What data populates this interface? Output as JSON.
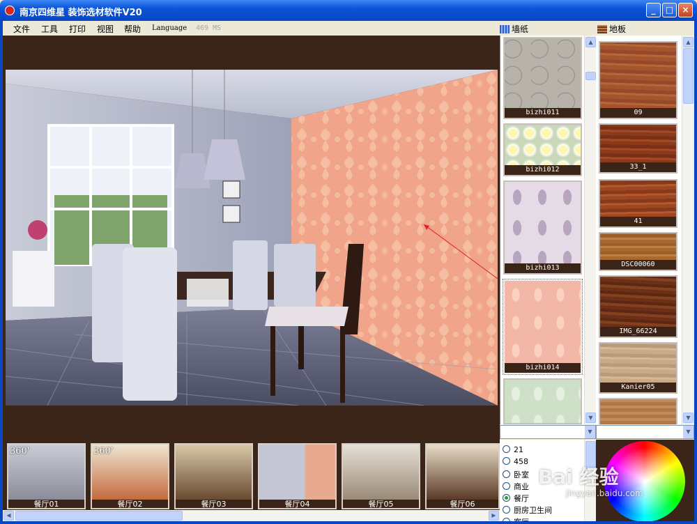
{
  "window": {
    "title": "南京四维星 装饰选材软件V20",
    "minimize": "_",
    "maximize": "□",
    "close": "×"
  },
  "menu": {
    "items": [
      "文件",
      "工具",
      "打印",
      "视图",
      "帮助"
    ],
    "language": "Language",
    "status": "469 MS"
  },
  "tabs": {
    "wallpaper": "墙纸",
    "floor": "地板"
  },
  "wallpapers": [
    {
      "label": "bizhi011",
      "color": "#b7b2aa"
    },
    {
      "label": "bizhi012",
      "color": "#c9d8b8"
    },
    {
      "label": "bizhi013",
      "color": "#e4dbe6"
    },
    {
      "label": "bizhi014",
      "color": "#f2b7a6",
      "selected": true
    },
    {
      "label": "",
      "color": "#cfe0c8"
    }
  ],
  "floors": [
    {
      "label": "09",
      "color": "#a4552d"
    },
    {
      "label": "33_1",
      "color": "#8a3b1a"
    },
    {
      "label": "41",
      "color": "#9b4721"
    },
    {
      "label": "DSC00060",
      "color": "#a8692e"
    },
    {
      "label": "IMG_66224",
      "color": "#6b3017"
    },
    {
      "label": "Kanier05",
      "color": "#c9a986"
    },
    {
      "label": "",
      "color": "#b07848"
    }
  ],
  "rooms": [
    {
      "label": "餐厅01",
      "tag": "360'"
    },
    {
      "label": "餐厅02",
      "tag": "360'"
    },
    {
      "label": "餐厅03",
      "tag": ""
    },
    {
      "label": "餐厅04",
      "tag": ""
    },
    {
      "label": "餐厅05",
      "tag": ""
    },
    {
      "label": "餐厅06",
      "tag": ""
    }
  ],
  "categories": [
    {
      "label": "21",
      "checked": false
    },
    {
      "label": "458",
      "checked": false
    },
    {
      "label": "卧室",
      "checked": false
    },
    {
      "label": "商业",
      "checked": false
    },
    {
      "label": "餐厅",
      "checked": true
    },
    {
      "label": "厨房卫生间",
      "checked": false
    },
    {
      "label": "客厅",
      "checked": false
    }
  ],
  "watermark": {
    "logo": "Bai 经验",
    "url": "jingyan.baidu.com"
  }
}
